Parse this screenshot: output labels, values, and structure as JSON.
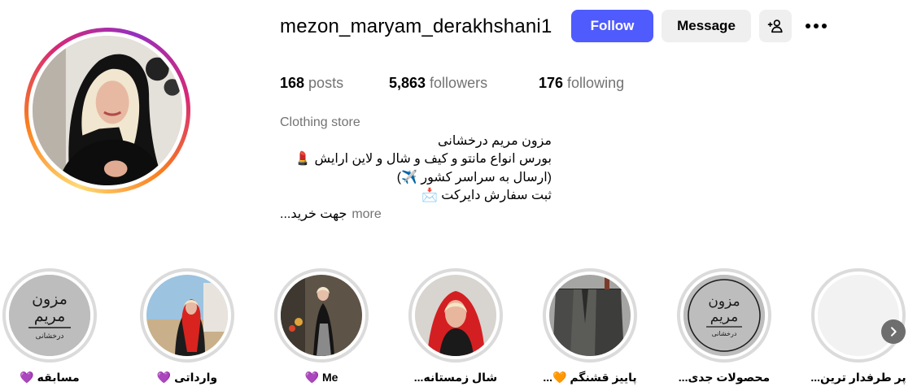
{
  "profile": {
    "username": "mezon_maryam_derakhshani1",
    "follow_label": "Follow",
    "message_label": "Message",
    "suggest_icon": "person-add-icon",
    "more_icon": "ellipsis-icon",
    "accent_color": "#4f5bfc"
  },
  "stats": {
    "posts_count": "168",
    "posts_label": "posts",
    "followers_count": "5,863",
    "followers_label": "followers",
    "following_count": "176",
    "following_label": "following"
  },
  "bio": {
    "category": "Clothing store",
    "line1": "مزون مریم درخشانی",
    "line2": "بورس انواع مانتو و کیف و شال و لاین ارایش 💄",
    "line3": "(ارسال به سراسر کشور ✈️)",
    "line4": "ثبت سفارش دایرکت 📩",
    "line5": "جهت خرید...",
    "more_label": "more"
  },
  "highlights": [
    {
      "label": "مسابقه 💜",
      "cover": "logo"
    },
    {
      "label": "وارداتی 💜",
      "cover": "photo-red-scarf-beach"
    },
    {
      "label": "Me 💜",
      "cover": "photo-black-dress"
    },
    {
      "label": "شال زمستانه...",
      "cover": "photo-red-scarf"
    },
    {
      "label": "پاییز قشنگم 🧡...",
      "cover": "photo-clothes-rack"
    },
    {
      "label": "محصولات جدی...",
      "cover": "logo"
    },
    {
      "label": "پر طرفدار ترین...",
      "cover": "blank"
    }
  ],
  "logo_text": {
    "line1": "مزون",
    "line2": "مریم",
    "line3": "درخشانی"
  },
  "next_icon": "chevron-right-icon"
}
